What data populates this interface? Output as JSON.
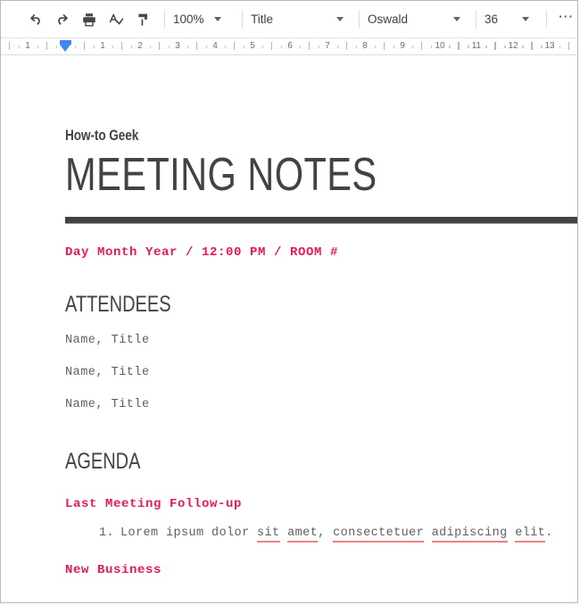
{
  "toolbar": {
    "icons": [
      {
        "name": "undo-icon",
        "label": "Undo"
      },
      {
        "name": "redo-icon",
        "label": "Redo"
      },
      {
        "name": "print-icon",
        "label": "Print"
      },
      {
        "name": "spelling-check-icon",
        "label": "Spelling and grammar check"
      },
      {
        "name": "paint-format-icon",
        "label": "Paint format"
      }
    ],
    "zoom": "100%",
    "paragraph_style": "Title",
    "font_family": "Oswald",
    "font_size": "36",
    "more_label": "⋯"
  },
  "ruler": {
    "numbers": [
      "1",
      "1",
      "2",
      "3",
      "4",
      "5",
      "6",
      "7",
      "8",
      "9",
      "10",
      "11",
      "12",
      "13"
    ],
    "indent_marker": "left-indent-marker"
  },
  "document": {
    "kicker": "How-to Geek",
    "title": "MEETING NOTES",
    "meta": "Day Month Year / 12:00 PM / ROOM #",
    "sections": [
      {
        "heading": "ATTENDEES",
        "lines": [
          "Name, Title",
          "Name, Title",
          "Name, Title"
        ]
      },
      {
        "heading": "AGENDA",
        "subheads": [
          "Last Meeting Follow-up",
          "New Business"
        ],
        "list": {
          "number": "1.",
          "text_plain": "Lorem ipsum dolor ",
          "flagged": [
            "sit",
            "amet",
            "consectetuer",
            "adipiscing",
            "elit"
          ],
          "comma": ",",
          "period": "."
        }
      }
    ]
  },
  "colors": {
    "accent_pink": "#e8175d",
    "heading_gray": "#434343",
    "body_gray": "#5b6069",
    "spellcheck_underline": "#f08080",
    "marker_blue": "#4285f4"
  }
}
